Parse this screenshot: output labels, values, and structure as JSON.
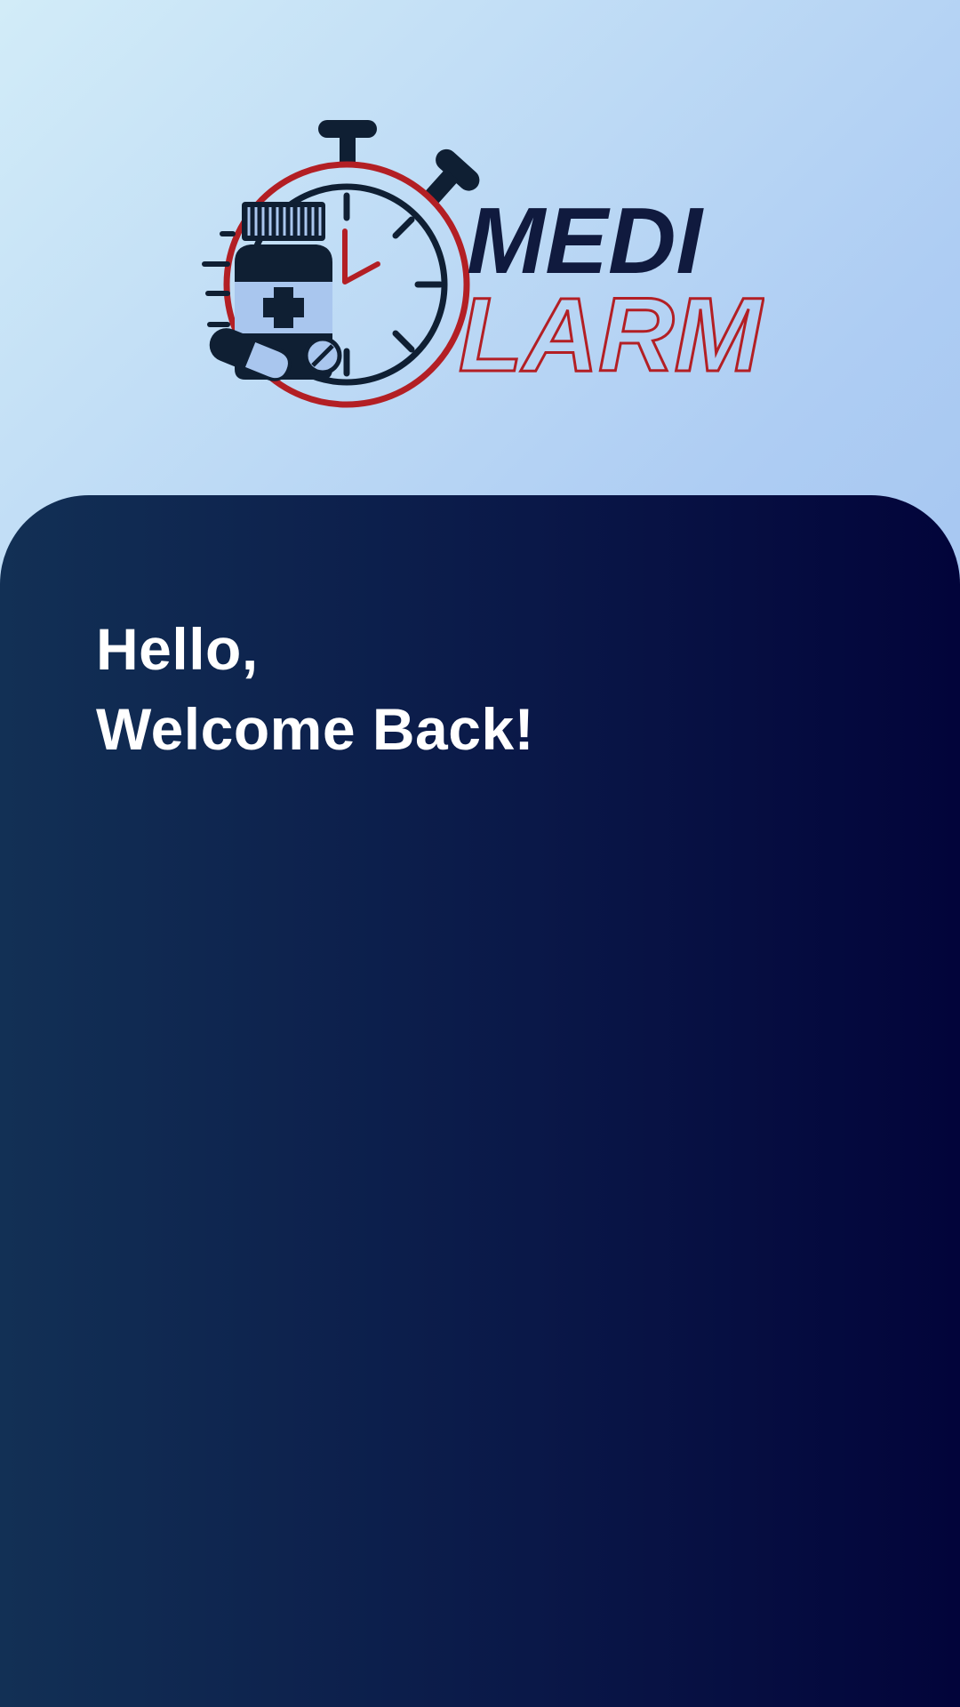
{
  "logo": {
    "line1": "MEDI",
    "line2": "LARM",
    "icons": [
      "stopwatch-icon",
      "medicine-bottle-icon",
      "pill-icon",
      "tablet-icon"
    ],
    "colors": {
      "navy": "#101a3e",
      "red": "#b31f24"
    }
  },
  "welcome": {
    "line1": "Hello,",
    "line2": "Welcome Back!"
  },
  "theme": {
    "header_gradient": [
      "#d2ecf8",
      "#8eb3ee"
    ],
    "panel_gradient": [
      "#123055",
      "#02043a"
    ],
    "text_color": "#ffffff"
  }
}
